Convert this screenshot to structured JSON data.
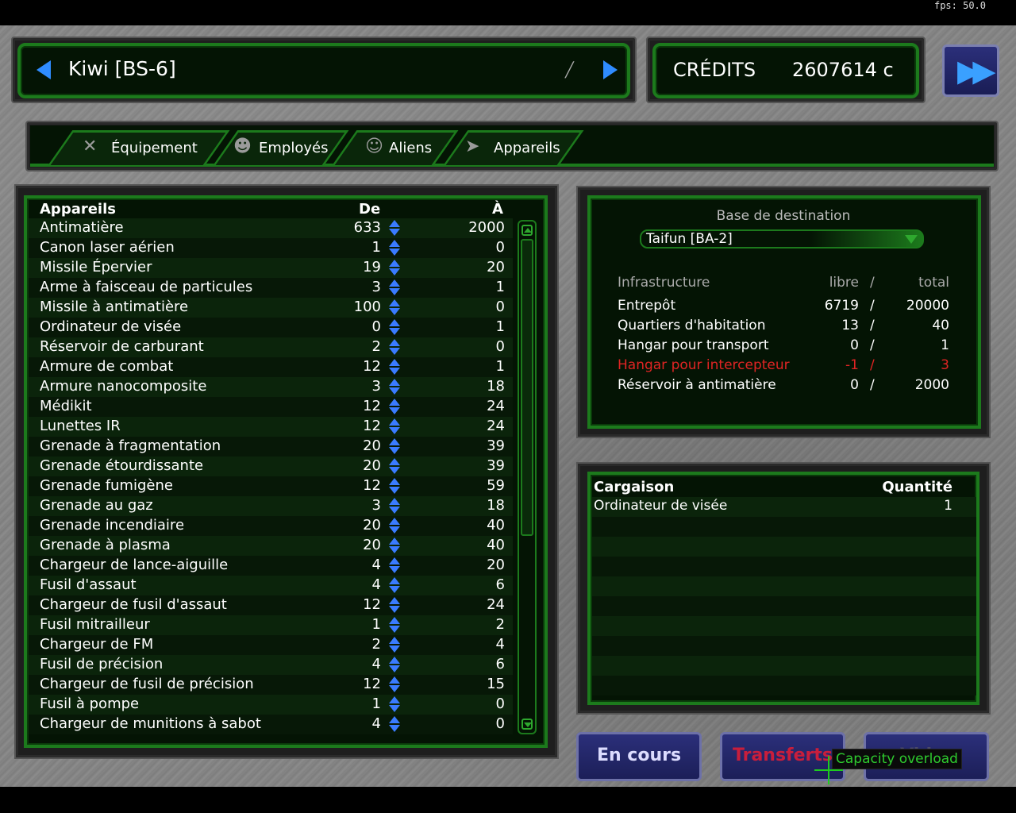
{
  "fps": "fps: 50.0",
  "base": {
    "name": "Kiwi [BS-6]"
  },
  "credits": {
    "label": "CRÉDITS",
    "value": "2607614 c"
  },
  "icons": {
    "prev": "left-arrow-icon",
    "next": "right-arrow-icon",
    "rename": "pencil-icon",
    "fastforward": "fast-forward-icon"
  },
  "tabs": [
    {
      "label": "Équipement",
      "icon": "tools-icon"
    },
    {
      "label": "Employés",
      "icon": "soldier-icon"
    },
    {
      "label": "Aliens",
      "icon": "alien-icon"
    },
    {
      "label": "Appareils",
      "icon": "aircraft-icon"
    }
  ],
  "list": {
    "headers": {
      "name": "Appareils",
      "from": "De",
      "to": "À"
    },
    "rows": [
      {
        "name": "Antimatière",
        "from": "633",
        "to": "2000"
      },
      {
        "name": "Canon laser aérien",
        "from": "1",
        "to": "0"
      },
      {
        "name": "Missile Épervier",
        "from": "19",
        "to": "20"
      },
      {
        "name": "Arme à faisceau de particules",
        "from": "3",
        "to": "1"
      },
      {
        "name": "Missile à antimatière",
        "from": "100",
        "to": "0"
      },
      {
        "name": "Ordinateur de visée",
        "from": "0",
        "to": "1"
      },
      {
        "name": "Réservoir de carburant",
        "from": "2",
        "to": "0"
      },
      {
        "name": "Armure de combat",
        "from": "12",
        "to": "1"
      },
      {
        "name": "Armure nanocomposite",
        "from": "3",
        "to": "18"
      },
      {
        "name": "Médikit",
        "from": "12",
        "to": "24"
      },
      {
        "name": "Lunettes IR",
        "from": "12",
        "to": "24"
      },
      {
        "name": "Grenade à fragmentation",
        "from": "20",
        "to": "39"
      },
      {
        "name": "Grenade étourdissante",
        "from": "20",
        "to": "39"
      },
      {
        "name": "Grenade fumigène",
        "from": "12",
        "to": "59"
      },
      {
        "name": "Grenade au gaz",
        "from": "3",
        "to": "18"
      },
      {
        "name": "Grenade incendiaire",
        "from": "20",
        "to": "40"
      },
      {
        "name": "Grenade à plasma",
        "from": "20",
        "to": "40"
      },
      {
        "name": "Chargeur de lance-aiguille",
        "from": "4",
        "to": "20"
      },
      {
        "name": "Fusil d'assaut",
        "from": "4",
        "to": "6"
      },
      {
        "name": "Chargeur de fusil d'assaut",
        "from": "12",
        "to": "24"
      },
      {
        "name": "Fusil mitrailleur",
        "from": "1",
        "to": "2"
      },
      {
        "name": "Chargeur de FM",
        "from": "2",
        "to": "4"
      },
      {
        "name": "Fusil de précision",
        "from": "4",
        "to": "6"
      },
      {
        "name": "Chargeur de fusil de précision",
        "from": "12",
        "to": "15"
      },
      {
        "name": "Fusil à pompe",
        "from": "1",
        "to": "0"
      },
      {
        "name": "Chargeur de munitions à sabot",
        "from": "4",
        "to": "0"
      }
    ]
  },
  "destination": {
    "title": "Base de destination",
    "selected": "Taifun [BA-2]",
    "infra_header": {
      "name": "Infrastructure",
      "free": "libre",
      "sep": "/",
      "total": "total"
    },
    "infra_rows": [
      {
        "name": "Entrepôt",
        "free": "6719",
        "sep": "/",
        "total": "20000",
        "alert": false
      },
      {
        "name": "Quartiers d'habitation",
        "free": "13",
        "sep": "/",
        "total": "40",
        "alert": false
      },
      {
        "name": "Hangar pour transport",
        "free": "0",
        "sep": "/",
        "total": "1",
        "alert": false
      },
      {
        "name": "Hangar pour intercepteur",
        "free": "-1",
        "sep": "/",
        "total": "3",
        "alert": true
      },
      {
        "name": "Réservoir à antimatière",
        "free": "0",
        "sep": "/",
        "total": "2000",
        "alert": false
      }
    ]
  },
  "cargo": {
    "headers": {
      "name": "Cargaison",
      "qty": "Quantité"
    },
    "rows": [
      {
        "name": "Ordinateur de visée",
        "qty": "1"
      },
      {
        "name": "",
        "qty": ""
      },
      {
        "name": "",
        "qty": ""
      },
      {
        "name": "",
        "qty": ""
      },
      {
        "name": "",
        "qty": ""
      },
      {
        "name": "",
        "qty": ""
      },
      {
        "name": "",
        "qty": ""
      },
      {
        "name": "",
        "qty": ""
      },
      {
        "name": "",
        "qty": ""
      },
      {
        "name": "",
        "qty": ""
      }
    ]
  },
  "buttons": {
    "in_progress": "En cours",
    "transfers": "Transferts",
    "empty": "Vider"
  },
  "tooltip": "Capacity overload",
  "colors": {
    "panel_green": "#1c7a1c",
    "alert_red": "#e02424",
    "button_blue": "#2b2f7a",
    "arrow_blue": "#2f8cff"
  }
}
